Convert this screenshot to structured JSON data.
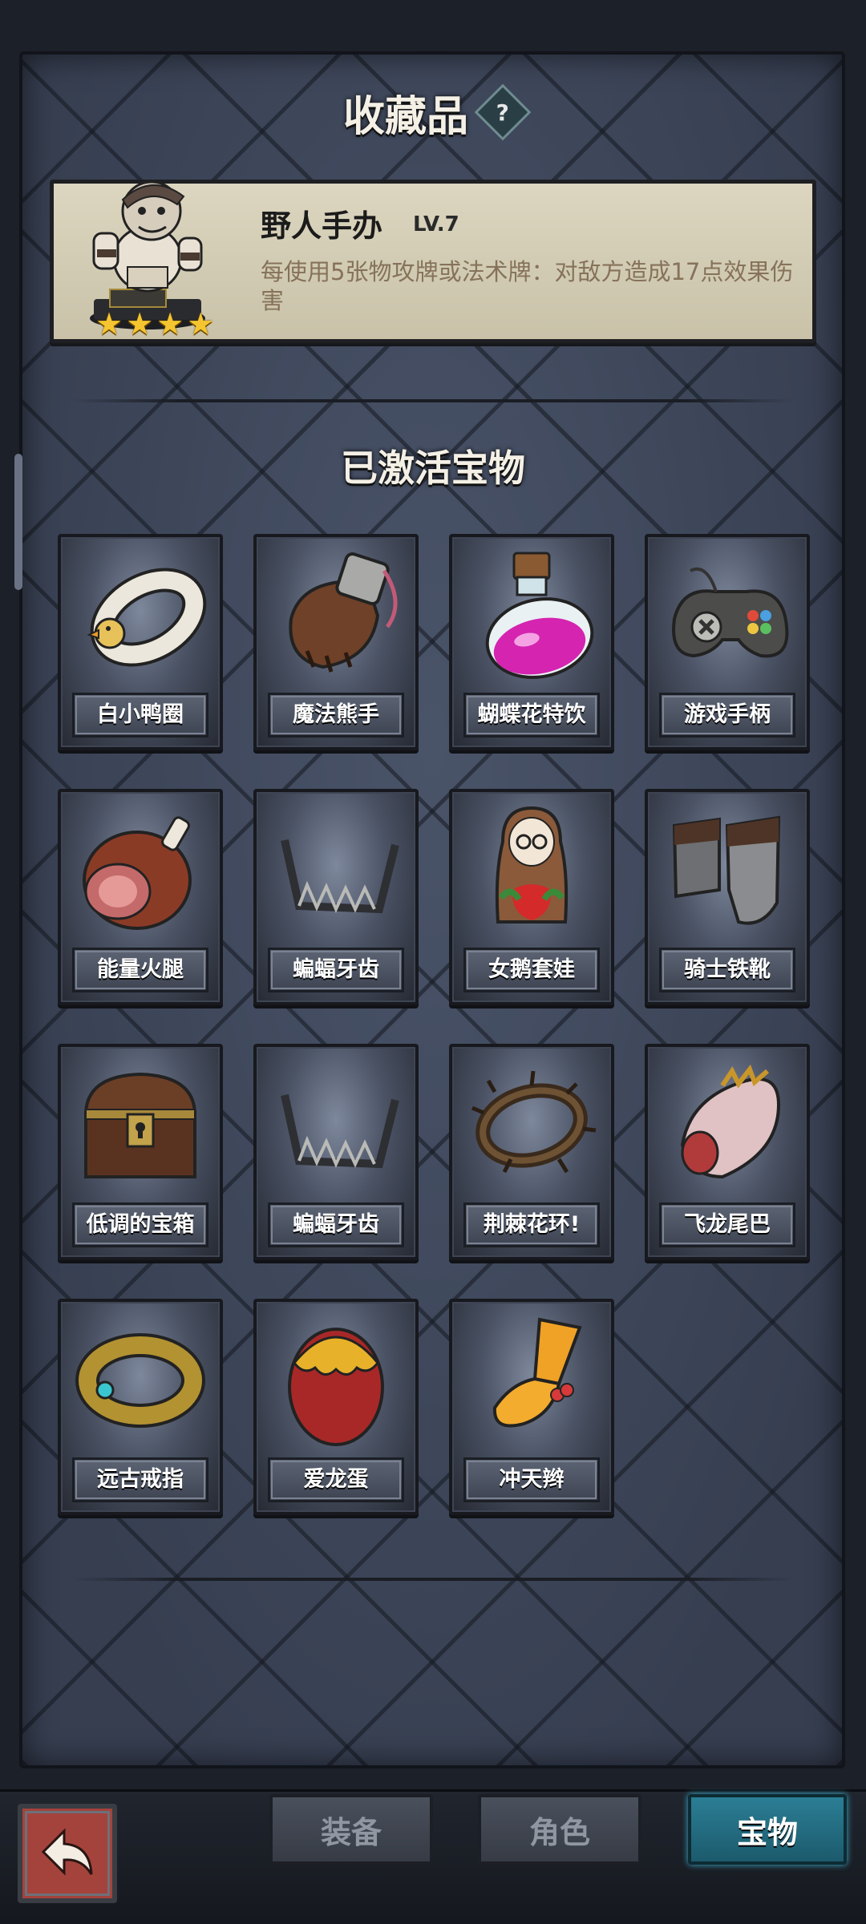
{
  "header": {
    "title": "收藏品",
    "help_label": "?"
  },
  "collectible": {
    "name": "野人手办",
    "level": "LV.7",
    "description": "每使用5张物攻牌或法术牌：对敌方造成17点效果伤害",
    "stars": 4
  },
  "section": {
    "title": "已激活宝物"
  },
  "treasures": [
    {
      "label": "白小鸭圈",
      "icon": "duck-ring-icon"
    },
    {
      "label": "魔法熊手",
      "icon": "bear-paw-icon"
    },
    {
      "label": "蝴蝶花特饮",
      "icon": "potion-icon"
    },
    {
      "label": "游戏手柄",
      "icon": "gamepad-icon"
    },
    {
      "label": "能量火腿",
      "icon": "ham-icon"
    },
    {
      "label": "蝙蝠牙齿",
      "icon": "bat-teeth-icon"
    },
    {
      "label": "女鹅套娃",
      "icon": "matryoshka-icon"
    },
    {
      "label": "骑士铁靴",
      "icon": "iron-boots-icon"
    },
    {
      "label": "低调的宝箱",
      "icon": "treasure-chest-icon"
    },
    {
      "label": "蝙蝠牙齿",
      "icon": "bat-teeth-icon"
    },
    {
      "label": "荆棘花环!",
      "icon": "thorn-wreath-icon"
    },
    {
      "label": "飞龙尾巴",
      "icon": "dragon-tail-icon"
    },
    {
      "label": "远古戒指",
      "icon": "ancient-ring-icon"
    },
    {
      "label": "爱龙蛋",
      "icon": "dragon-egg-icon"
    },
    {
      "label": "冲天辫",
      "icon": "pigtail-icon"
    }
  ],
  "nav": {
    "back_icon": "back-arrow-icon",
    "tabs": [
      {
        "label": "装备",
        "active": false
      },
      {
        "label": "角色",
        "active": false
      },
      {
        "label": "宝物",
        "active": true
      }
    ]
  },
  "colors": {
    "accent_tab": "#2b7e95",
    "back_button": "#a4433c",
    "star": "#f5c531"
  }
}
